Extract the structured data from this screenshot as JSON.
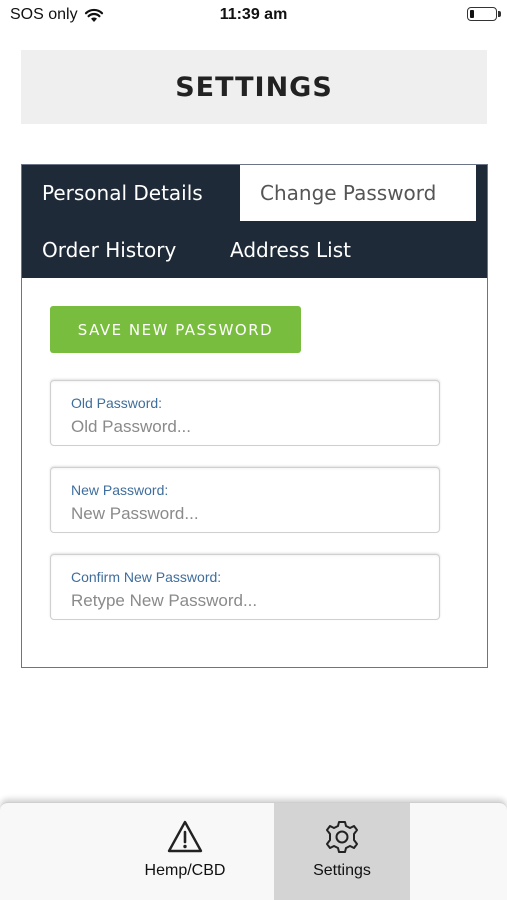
{
  "status_bar": {
    "carrier": "SOS only",
    "time": "11:39 am"
  },
  "header": {
    "title": "SETTINGS"
  },
  "tabs": {
    "personal_details": "Personal Details",
    "change_password": "Change Password",
    "order_history": "Order History",
    "address_list": "Address List",
    "active": "Change Password"
  },
  "form": {
    "save_button": "SAVE NEW PASSWORD",
    "old_password": {
      "label": "Old Password:",
      "placeholder": "Old Password..."
    },
    "new_password": {
      "label": "New Password:",
      "placeholder": "New Password..."
    },
    "confirm_password": {
      "label": "Confirm New Password:",
      "placeholder": "Retype New Password..."
    }
  },
  "bottom_nav": {
    "items": [
      {
        "label": "Hemp/CBD",
        "icon": "warning-triangle-icon"
      },
      {
        "label": "Settings",
        "icon": "gear-icon",
        "selected": true
      }
    ]
  },
  "colors": {
    "tab_bar_bg": "#1f2a38",
    "save_button": "#79bd3f",
    "field_label": "#3f6e9c",
    "selected_nav_bg": "#d4d4d4"
  }
}
